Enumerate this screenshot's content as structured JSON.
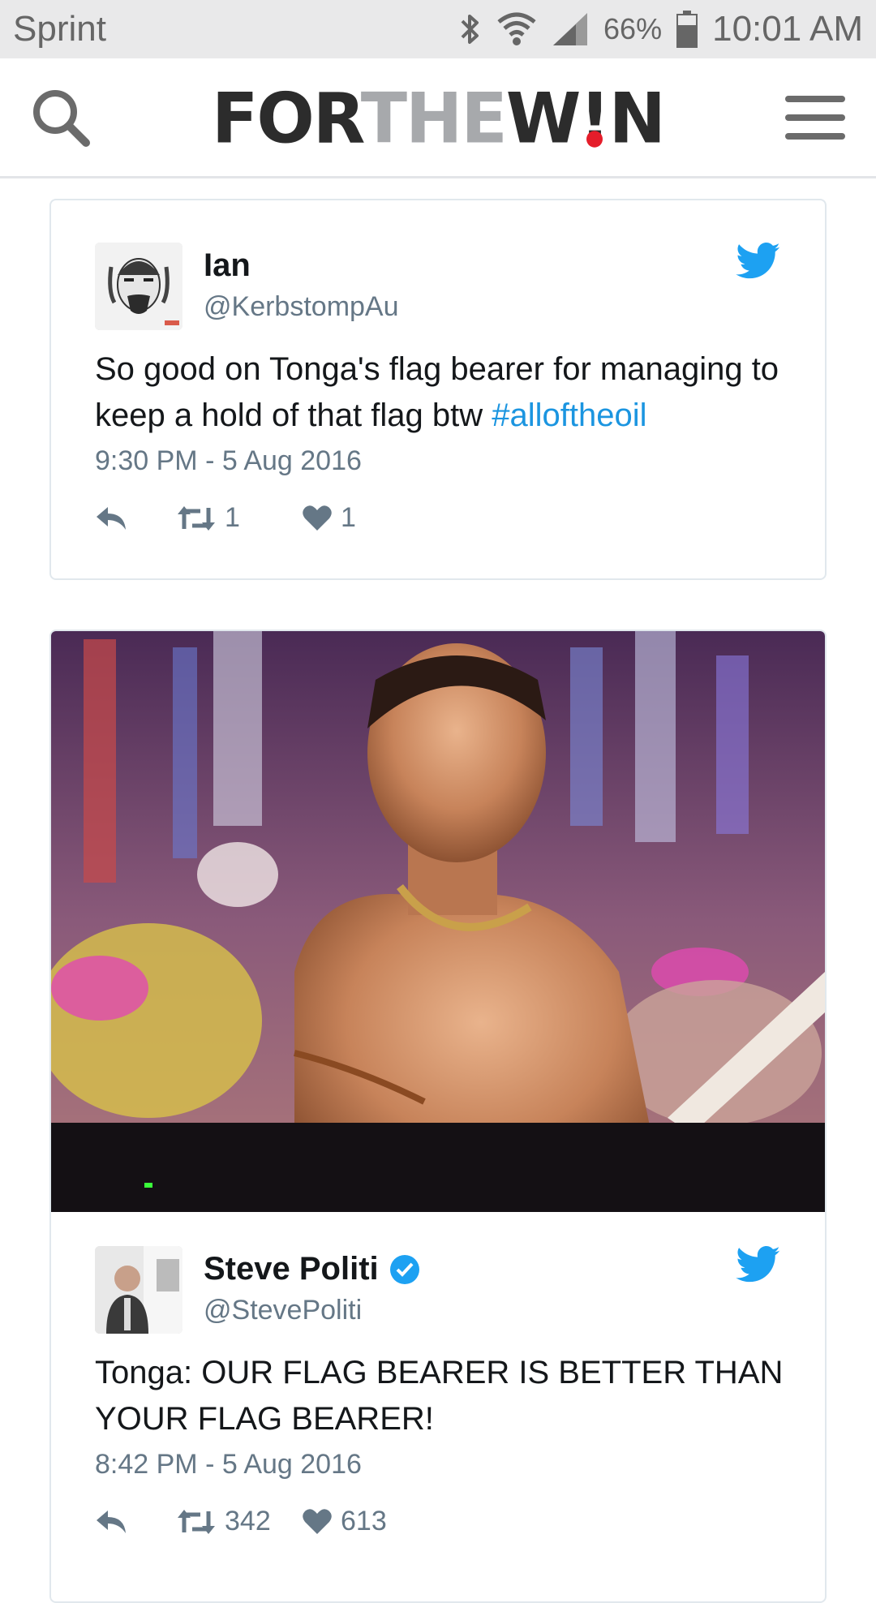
{
  "status_bar": {
    "carrier": "Sprint",
    "battery_percent": "66%",
    "time": "10:01 AM"
  },
  "header": {
    "logo_parts": [
      "FOR",
      "THE",
      "W",
      "!",
      "N"
    ],
    "icons": {
      "search": "search-icon",
      "menu": "hamburger-menu-icon"
    }
  },
  "tweets": [
    {
      "name": "Ian",
      "handle": "@KerbstompAu",
      "verified": false,
      "text": "So good on Tonga's flag bearer for managing to keep a hold of that flag btw ",
      "hashtag": "#alloftheoil",
      "time": "9:30 PM - 5 Aug 2016",
      "retweets": "1",
      "likes": "1"
    },
    {
      "name": "Steve Politi",
      "handle": "@StevePoliti",
      "verified": true,
      "text": "Tonga: OUR FLAG BEARER IS BETTER THAN YOUR FLAG BEARER!",
      "hashtag": "",
      "time": "8:42 PM - 5 Aug 2016",
      "retweets": "342",
      "likes": "613"
    }
  ],
  "colors": {
    "twitter_blue": "#1da1f2",
    "link_blue": "#1b95e0",
    "logo_dark": "#2c2c2c",
    "logo_grey": "#a7a9ac",
    "logo_red": "#e51d2a"
  }
}
